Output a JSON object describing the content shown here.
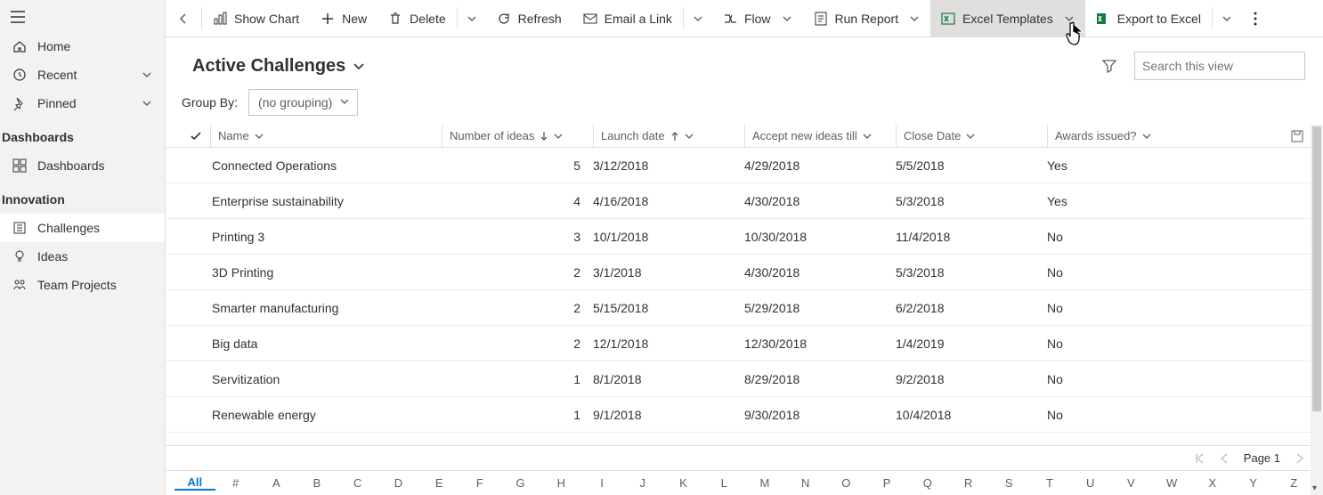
{
  "sidebar": {
    "items": [
      {
        "label": "Home"
      },
      {
        "label": "Recent"
      },
      {
        "label": "Pinned"
      }
    ],
    "sections": [
      {
        "title": "Dashboards",
        "items": [
          {
            "label": "Dashboards"
          }
        ]
      },
      {
        "title": "Innovation",
        "items": [
          {
            "label": "Challenges"
          },
          {
            "label": "Ideas"
          },
          {
            "label": "Team Projects"
          }
        ]
      }
    ]
  },
  "commands": {
    "show_chart": "Show Chart",
    "new": "New",
    "delete": "Delete",
    "refresh": "Refresh",
    "email_link": "Email a Link",
    "flow": "Flow",
    "run_report": "Run Report",
    "excel_templates": "Excel Templates",
    "export_excel": "Export to Excel"
  },
  "view": {
    "title": "Active Challenges",
    "search_placeholder": "Search this view",
    "group_by_label": "Group By:",
    "group_by_value": "(no grouping)"
  },
  "columns": {
    "name": "Name",
    "num_ideas": "Number of ideas",
    "launch": "Launch date",
    "accept": "Accept new ideas till",
    "close": "Close Date",
    "awards": "Awards issued?"
  },
  "rows": [
    {
      "name": "Connected Operations",
      "num": "5",
      "launch": "3/12/2018",
      "accept": "4/29/2018",
      "close": "5/5/2018",
      "awards": "Yes"
    },
    {
      "name": "Enterprise sustainability",
      "num": "4",
      "launch": "4/16/2018",
      "accept": "4/30/2018",
      "close": "5/3/2018",
      "awards": "Yes"
    },
    {
      "name": "Printing 3",
      "num": "3",
      "launch": "10/1/2018",
      "accept": "10/30/2018",
      "close": "11/4/2018",
      "awards": "No"
    },
    {
      "name": "3D Printing",
      "num": "2",
      "launch": "3/1/2018",
      "accept": "4/30/2018",
      "close": "5/3/2018",
      "awards": "No"
    },
    {
      "name": "Smarter manufacturing",
      "num": "2",
      "launch": "5/15/2018",
      "accept": "5/29/2018",
      "close": "6/2/2018",
      "awards": "No"
    },
    {
      "name": "Big data",
      "num": "2",
      "launch": "12/1/2018",
      "accept": "12/30/2018",
      "close": "1/4/2019",
      "awards": "No"
    },
    {
      "name": "Servitization",
      "num": "1",
      "launch": "8/1/2018",
      "accept": "8/29/2018",
      "close": "9/2/2018",
      "awards": "No"
    },
    {
      "name": "Renewable energy",
      "num": "1",
      "launch": "9/1/2018",
      "accept": "9/30/2018",
      "close": "10/4/2018",
      "awards": "No"
    }
  ],
  "pager": {
    "page_label": "Page 1"
  },
  "alpha": [
    "All",
    "#",
    "A",
    "B",
    "C",
    "D",
    "E",
    "F",
    "G",
    "H",
    "I",
    "J",
    "K",
    "L",
    "M",
    "N",
    "O",
    "P",
    "Q",
    "R",
    "S",
    "T",
    "U",
    "V",
    "W",
    "X",
    "Y",
    "Z"
  ]
}
